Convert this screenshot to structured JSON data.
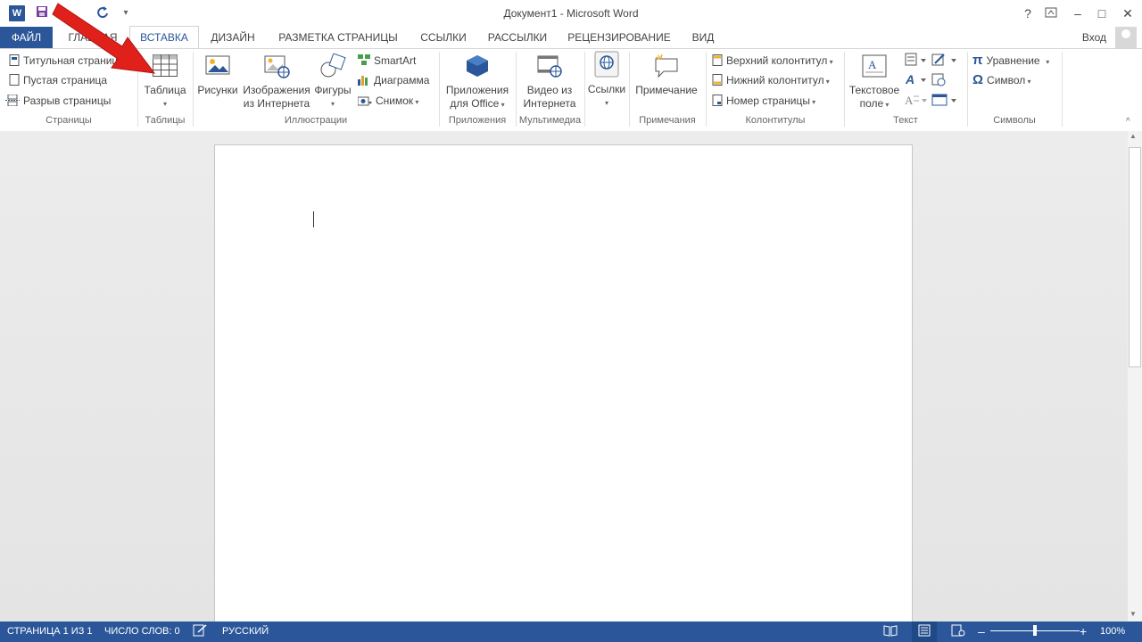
{
  "window": {
    "title": "Документ1 - Microsoft Word",
    "help": "?",
    "minimize": "–",
    "maximize": "□",
    "close": "✕",
    "restore_ribbon": "⧉"
  },
  "qat": {
    "app_icon": "W",
    "save": "💾",
    "undo": "↶",
    "redo": "↻",
    "customize": "₹"
  },
  "tabs": [
    "ФАЙЛ",
    "ГЛАВНАЯ",
    "ВСТАВКА",
    "ДИЗАЙН",
    "РАЗМЕТКА СТРАНИЦЫ",
    "ССЫЛКИ",
    "РАССЫЛКИ",
    "РЕЦЕНЗИРОВАНИЕ",
    "ВИД"
  ],
  "account": {
    "login": "Вход"
  },
  "ribbon": {
    "pages": {
      "label": "Страницы",
      "items": [
        "Титульная страница",
        "Пустая страница",
        "Разрыв страницы"
      ]
    },
    "tables": {
      "label": "Таблицы",
      "table": "Таблица"
    },
    "illustrations": {
      "label": "Иллюстрации",
      "pictures": "Рисунки",
      "online_pictures_1": "Изображения",
      "online_pictures_2": "из Интернета",
      "shapes": "Фигуры",
      "smartart": "SmartArt",
      "chart": "Диаграмма",
      "screenshot": "Снимок"
    },
    "apps": {
      "label": "Приложения",
      "line1": "Приложения",
      "line2": "для Office"
    },
    "media": {
      "label": "Мультимедиа",
      "line1": "Видео из",
      "line2": "Интернета"
    },
    "links": {
      "label": "",
      "links": "Ссылки"
    },
    "comments": {
      "label": "Примечания",
      "comment": "Примечание"
    },
    "header_footer": {
      "label": "Колонтитулы",
      "header": "Верхний колонтитул",
      "footer": "Нижний колонтитул",
      "page_number": "Номер страницы"
    },
    "text": {
      "label": "Текст",
      "line1": "Текстовое",
      "line2": "поле"
    },
    "symbols": {
      "label": "Символы",
      "equation": "Уравнение",
      "symbol": "Символ"
    }
  },
  "status": {
    "page": "СТРАНИЦА 1 ИЗ 1",
    "words": "ЧИСЛО СЛОВ: 0",
    "language": "РУССКИЙ",
    "zoom": "100%",
    "zoom_percent": 100
  },
  "colors": {
    "accent": "#2b579a",
    "arrow": "#e0201a"
  }
}
